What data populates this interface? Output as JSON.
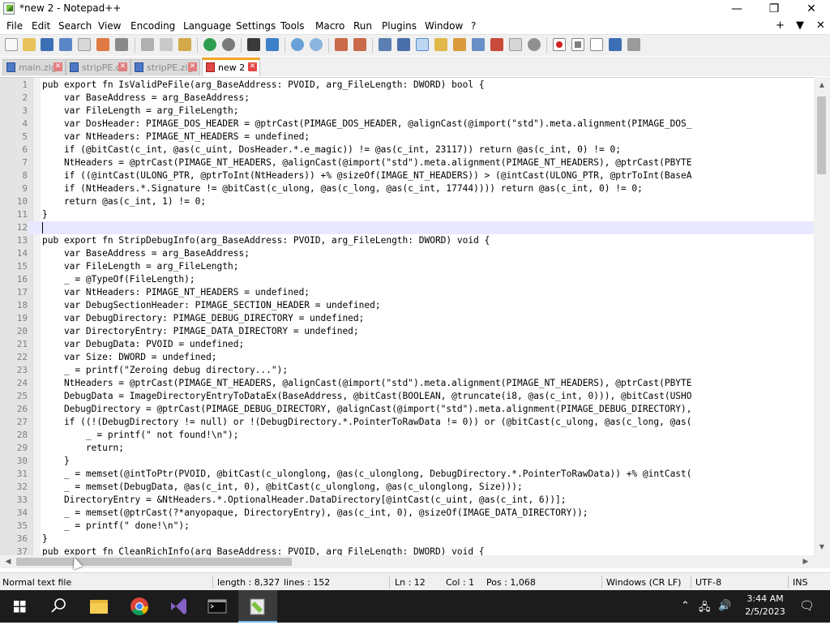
{
  "window": {
    "title": "*new 2 - Notepad++",
    "minimize_icon": "minimize-icon",
    "maximize_icon": "restore-icon",
    "close_icon": "close-icon"
  },
  "menu": {
    "items": [
      "File",
      "Edit",
      "Search",
      "View",
      "Encoding",
      "Language",
      "Settings",
      "Tools",
      "Macro",
      "Run",
      "Plugins",
      "Window",
      "?"
    ],
    "right": [
      "+",
      "▼",
      "✕"
    ]
  },
  "tabs": [
    {
      "label": "main.zig",
      "active": false
    },
    {
      "label": "stripPE.c",
      "active": false
    },
    {
      "label": "stripPE.zig",
      "active": false
    },
    {
      "label": "new 2",
      "active": true
    }
  ],
  "editor": {
    "current_line": 12,
    "lines": [
      "pub export fn IsValidPeFile(arg_BaseAddress: PVOID, arg_FileLength: DWORD) bool {",
      "    var BaseAddress = arg_BaseAddress;",
      "    var FileLength = arg_FileLength;",
      "    var DosHeader: PIMAGE_DOS_HEADER = @ptrCast(PIMAGE_DOS_HEADER, @alignCast(@import(\"std\").meta.alignment(PIMAGE_DOS_",
      "    var NtHeaders: PIMAGE_NT_HEADERS = undefined;",
      "    if (@bitCast(c_int, @as(c_uint, DosHeader.*.e_magic)) != @as(c_int, 23117)) return @as(c_int, 0) != 0;",
      "    NtHeaders = @ptrCast(PIMAGE_NT_HEADERS, @alignCast(@import(\"std\").meta.alignment(PIMAGE_NT_HEADERS), @ptrCast(PBYTE",
      "    if ((@intCast(ULONG_PTR, @ptrToInt(NtHeaders)) +% @sizeOf(IMAGE_NT_HEADERS)) > (@intCast(ULONG_PTR, @ptrToInt(BaseA",
      "    if (NtHeaders.*.Signature != @bitCast(c_ulong, @as(c_long, @as(c_int, 17744)))) return @as(c_int, 0) != 0;",
      "    return @as(c_int, 1) != 0;",
      "}",
      "",
      "pub export fn StripDebugInfo(arg_BaseAddress: PVOID, arg_FileLength: DWORD) void {",
      "    var BaseAddress = arg_BaseAddress;",
      "    var FileLength = arg_FileLength;",
      "    _ = @TypeOf(FileLength);",
      "    var NtHeaders: PIMAGE_NT_HEADERS = undefined;",
      "    var DebugSectionHeader: PIMAGE_SECTION_HEADER = undefined;",
      "    var DebugDirectory: PIMAGE_DEBUG_DIRECTORY = undefined;",
      "    var DirectoryEntry: PIMAGE_DATA_DIRECTORY = undefined;",
      "    var DebugData: PVOID = undefined;",
      "    var Size: DWORD = undefined;",
      "    _ = printf(\"Zeroing debug directory...\");",
      "    NtHeaders = @ptrCast(PIMAGE_NT_HEADERS, @alignCast(@import(\"std\").meta.alignment(PIMAGE_NT_HEADERS), @ptrCast(PBYTE",
      "    DebugData = ImageDirectoryEntryToDataEx(BaseAddress, @bitCast(BOOLEAN, @truncate(i8, @as(c_int, 0))), @bitCast(USHO",
      "    DebugDirectory = @ptrCast(PIMAGE_DEBUG_DIRECTORY, @alignCast(@import(\"std\").meta.alignment(PIMAGE_DEBUG_DIRECTORY),",
      "    if ((!(DebugDirectory != null) or !(DebugDirectory.*.PointerToRawData != 0)) or (@bitCast(c_ulong, @as(c_long, @as(",
      "        _ = printf(\" not found!\\n\");",
      "        return;",
      "    }",
      "    _ = memset(@intToPtr(PVOID, @bitCast(c_ulonglong, @as(c_ulonglong, DebugDirectory.*.PointerToRawData)) +% @intCast(",
      "    _ = memset(DebugData, @as(c_int, 0), @bitCast(c_ulonglong, @as(c_ulonglong, Size)));",
      "    DirectoryEntry = &NtHeaders.*.OptionalHeader.DataDirectory[@intCast(c_uint, @as(c_int, 6))];",
      "    _ = memset(@ptrCast(?*anyopaque, DirectoryEntry), @as(c_int, 0), @sizeOf(IMAGE_DATA_DIRECTORY));",
      "    _ = printf(\" done!\\n\");",
      "}",
      "pub export fn CleanRichInfo(arg_BaseAddress: PVOID, arg_FileLength: DWORD) void {"
    ]
  },
  "status": {
    "type": "Normal text file",
    "length": "length : 8,327",
    "lines": "lines : 152",
    "ln": "Ln : 12",
    "col": "Col : 1",
    "pos": "Pos : 1,068",
    "eol": "Windows (CR LF)",
    "encoding": "UTF-8",
    "mode": "INS"
  },
  "taskbar": {
    "time": "3:44 AM",
    "date": "2/5/2023",
    "apps": [
      "start-icon",
      "search-icon",
      "file-explorer-icon",
      "chrome-icon",
      "visual-studio-icon",
      "terminal-icon",
      "notepadpp-icon"
    ]
  }
}
